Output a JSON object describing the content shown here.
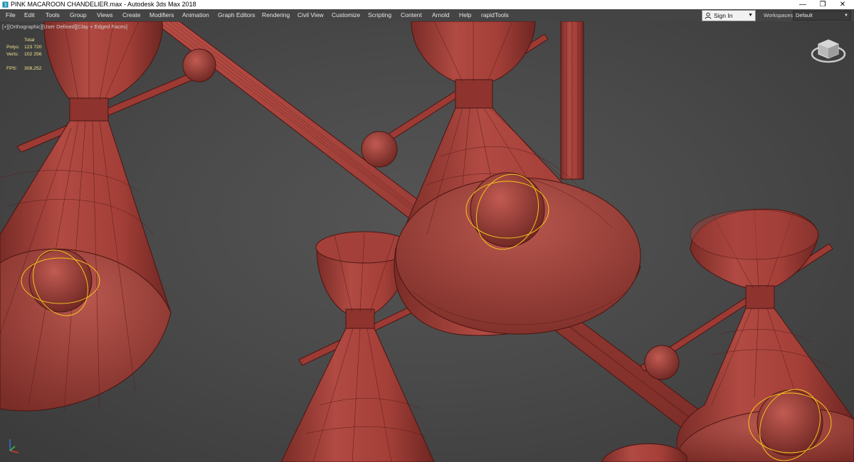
{
  "window": {
    "title": "PINK MACAROON CHANDELIER.max - Autodesk 3ds Max 2018",
    "minimize": "—",
    "restore": "❐",
    "close": "✕"
  },
  "menu": [
    "File",
    "Edit",
    "Tools",
    "Group",
    "Views",
    "Create",
    "Modifiers",
    "Animation",
    "Graph Editors",
    "Rendering",
    "Civil View",
    "Customize",
    "Scripting",
    "Content",
    "Arnold",
    "Help",
    "rapidTools"
  ],
  "account": {
    "sign_in": "Sign In",
    "workspaces_label": "Workspaces:",
    "workspace_value": "Default"
  },
  "viewport": {
    "labels": [
      "[+]",
      "[Orthographic]",
      "[User Defined]",
      "[Clay + Edged Faces]"
    ],
    "stats": {
      "header": "Total",
      "polys_label": "Polys:",
      "polys_value": "123 720",
      "verts_label": "Verts:",
      "verts_value": "102 256",
      "fps_label": "FPS:",
      "fps_value": "308,252"
    }
  },
  "colors": {
    "clay": "#a9423b",
    "clay_dark": "#7a2c27",
    "wire": "#4a1512",
    "selection": "#f5c518",
    "stats_text": "#f0e68c"
  },
  "icons": [
    "app-icon",
    "user-icon",
    "viewcube-icon",
    "axis-tripod-icon"
  ]
}
